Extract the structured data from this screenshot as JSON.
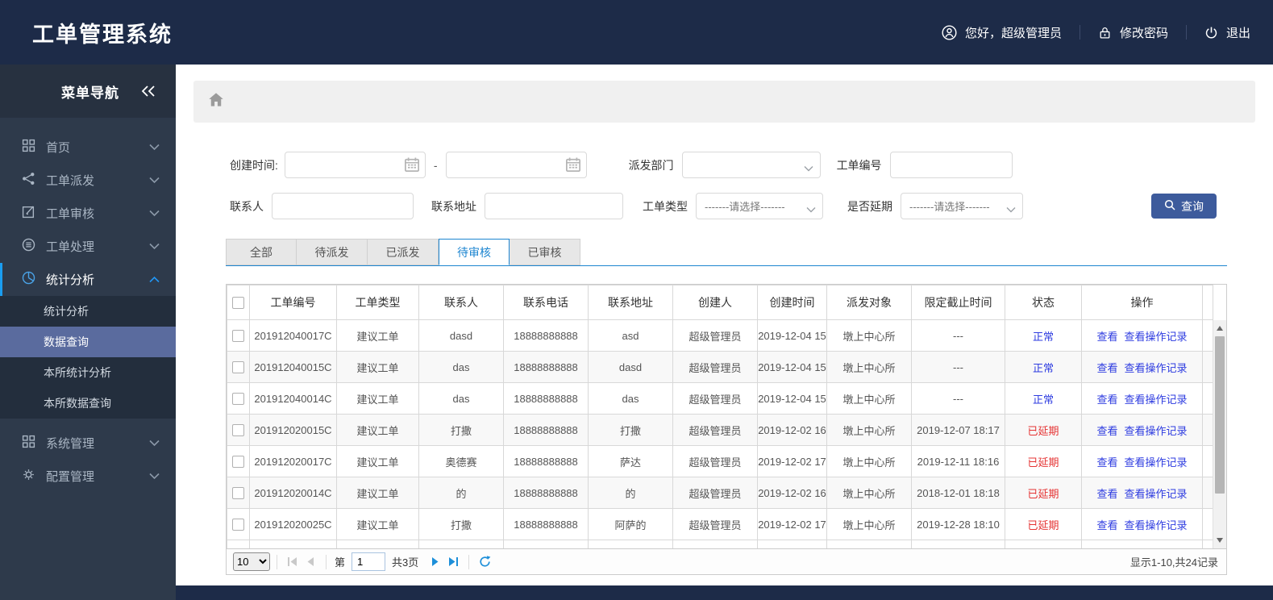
{
  "header": {
    "title": "工单管理系统",
    "greeting": "您好，超级管理员",
    "change_password": "修改密码",
    "logout": "退出"
  },
  "sidebar": {
    "title": "菜单导航",
    "items": [
      {
        "label": "首页"
      },
      {
        "label": "工单派发"
      },
      {
        "label": "工单审核"
      },
      {
        "label": "工单处理"
      },
      {
        "label": "统计分析",
        "active": true
      },
      {
        "label": "系统管理"
      },
      {
        "label": "配置管理"
      }
    ],
    "submenu": [
      {
        "label": "统计分析"
      },
      {
        "label": "数据查询",
        "selected": true
      },
      {
        "label": "本所统计分析"
      },
      {
        "label": "本所数据查询"
      }
    ]
  },
  "filters": {
    "create_time_label": "创建时间:",
    "range_separator": "-",
    "dispatch_dept_label": "派发部门",
    "order_no_label": "工单编号",
    "contact_label": "联系人",
    "address_label": "联系地址",
    "order_type_label": "工单类型",
    "delay_label": "是否延期",
    "select_placeholder": "-------请选择-------",
    "search_button": "查询"
  },
  "tabs": [
    {
      "label": "全部"
    },
    {
      "label": "待派发"
    },
    {
      "label": "已派发"
    },
    {
      "label": "待审核",
      "active": true
    },
    {
      "label": "已审核"
    }
  ],
  "table": {
    "columns": [
      "工单编号",
      "工单类型",
      "联系人",
      "联系电话",
      "联系地址",
      "创建人",
      "创建时间",
      "派发对象",
      "限定截止时间",
      "状态",
      "操作"
    ],
    "actions": [
      "查看",
      "查看操作记录"
    ],
    "rows": [
      {
        "order_no": "201912040017C",
        "type": "建议工单",
        "contact": "dasd",
        "phone": "18888888888",
        "address": "asd",
        "creator": "超级管理员",
        "created": "2019-12-04 15",
        "target": "墩上中心所",
        "deadline": "---",
        "status": "正常",
        "delayed": false
      },
      {
        "order_no": "201912040015C",
        "type": "建议工单",
        "contact": "das",
        "phone": "18888888888",
        "address": "dasd",
        "creator": "超级管理员",
        "created": "2019-12-04 15",
        "target": "墩上中心所",
        "deadline": "---",
        "status": "正常",
        "delayed": false
      },
      {
        "order_no": "201912040014C",
        "type": "建议工单",
        "contact": "das",
        "phone": "18888888888",
        "address": "das",
        "creator": "超级管理员",
        "created": "2019-12-04 15",
        "target": "墩上中心所",
        "deadline": "---",
        "status": "正常",
        "delayed": false
      },
      {
        "order_no": "201912020015C",
        "type": "建议工单",
        "contact": "打撒",
        "phone": "18888888888",
        "address": "打撒",
        "creator": "超级管理员",
        "created": "2019-12-02 16",
        "target": "墩上中心所",
        "deadline": "2019-12-07 18:17",
        "status": "已延期",
        "delayed": true
      },
      {
        "order_no": "201912020017C",
        "type": "建议工单",
        "contact": "奥德赛",
        "phone": "18888888888",
        "address": "萨达",
        "creator": "超级管理员",
        "created": "2019-12-02 17",
        "target": "墩上中心所",
        "deadline": "2019-12-11 18:16",
        "status": "已延期",
        "delayed": true
      },
      {
        "order_no": "201912020014C",
        "type": "建议工单",
        "contact": "的",
        "phone": "18888888888",
        "address": "的",
        "creator": "超级管理员",
        "created": "2019-12-02 16",
        "target": "墩上中心所",
        "deadline": "2018-12-01 18:18",
        "status": "已延期",
        "delayed": true
      },
      {
        "order_no": "201912020025C",
        "type": "建议工单",
        "contact": "打撒",
        "phone": "18888888888",
        "address": "阿萨的",
        "creator": "超级管理员",
        "created": "2019-12-02 17",
        "target": "墩上中心所",
        "deadline": "2019-12-28 18:10",
        "status": "已延期",
        "delayed": true
      }
    ]
  },
  "pagination": {
    "page_size": "10",
    "page_prefix": "第",
    "current_page": "1",
    "total_pages": "共3页",
    "summary": "显示1-10,共24记录"
  },
  "colors": {
    "header_bg": "#1d2b48",
    "sidebar_bg": "#2e3a4b",
    "accent_blue": "#1d85d0",
    "link_blue": "#2d3be0",
    "status_delayed": "#e53333",
    "selected_submenu_bg": "#5a6b9e",
    "query_button_bg": "#3d5b9c"
  }
}
